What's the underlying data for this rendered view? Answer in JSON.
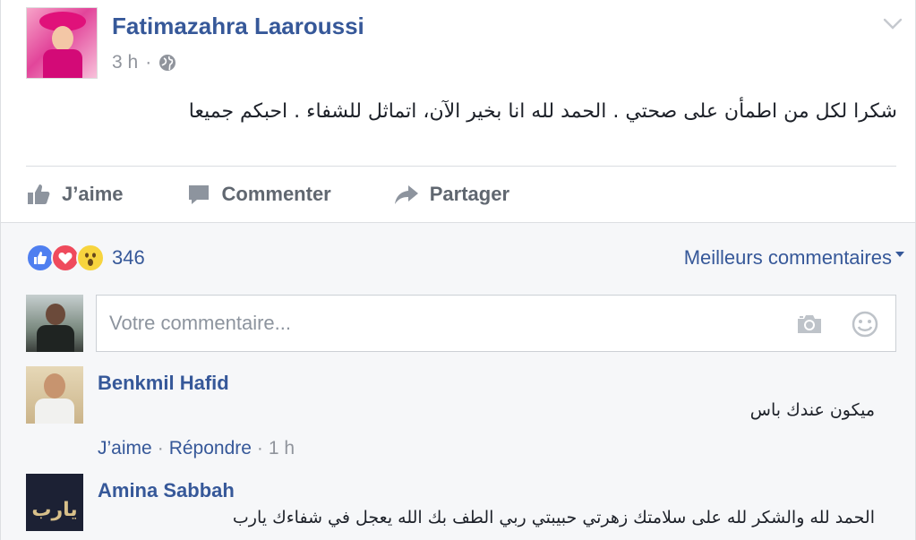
{
  "post": {
    "author": "Fatimazahra Laaroussi",
    "time": "3 h",
    "separator": "·",
    "text": "شكرا لكل من اطمأن على صحتي . الحمد لله انا بخير الآن، اتماثل للشفاء . احبكم جميعا"
  },
  "actions": {
    "like": "J’aime",
    "comment": "Commenter",
    "share": "Partager"
  },
  "reactions": {
    "count": "346",
    "types": [
      "like",
      "love",
      "wow"
    ],
    "colors": {
      "like": "#4f7ff0",
      "love": "#ef4a5c",
      "wow": "#f7d43e"
    }
  },
  "sort": {
    "label": "Meilleurs commentaires"
  },
  "composer": {
    "placeholder": "Votre commentaire..."
  },
  "comments": [
    {
      "author": "Benkmil Hafid",
      "text": "ميكون عندك باس",
      "like": "J’aime",
      "reply": "Répondre",
      "time": "1 h",
      "sep": "·"
    },
    {
      "author": "Amina Sabbah",
      "text": "الحمد لله والشكر لله على سلامتك زهرتي حبيبتي ربي الطف بك الله يعجل في شفاءك يارب",
      "avatar_text": "يارب"
    }
  ],
  "theme": {
    "link_blue": "#365899",
    "muted_gray": "#90949c",
    "action_gray": "#606770"
  }
}
